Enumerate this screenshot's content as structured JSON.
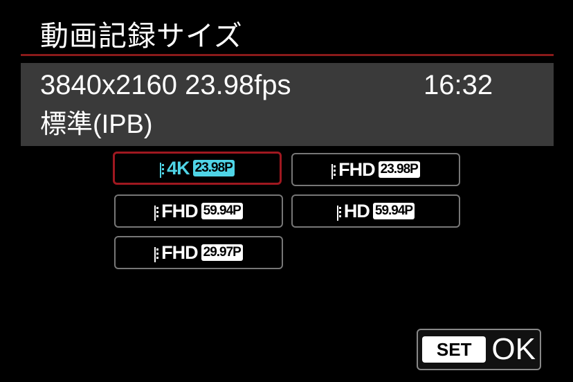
{
  "header": {
    "title": "動画記録サイズ"
  },
  "info": {
    "resolution_fps": "3840x2160 23.98fps",
    "remaining_time": "16:32",
    "compression": "標準(IPB)"
  },
  "options": [
    {
      "size": "4K",
      "fps": "23.98P",
      "selected": true
    },
    {
      "size": "FHD",
      "fps": "23.98P",
      "selected": false
    },
    {
      "size": "FHD",
      "fps": "59.94P",
      "selected": false
    },
    {
      "size": "HD",
      "fps": "59.94P",
      "selected": false
    },
    {
      "size": "FHD",
      "fps": "29.97P",
      "selected": false
    }
  ],
  "footer": {
    "set_label": "SET",
    "ok_label": "OK"
  },
  "colors": {
    "accent_cyan": "#4fd4e6",
    "selection_red": "#a01820",
    "panel_gray": "#3a3a3a"
  }
}
